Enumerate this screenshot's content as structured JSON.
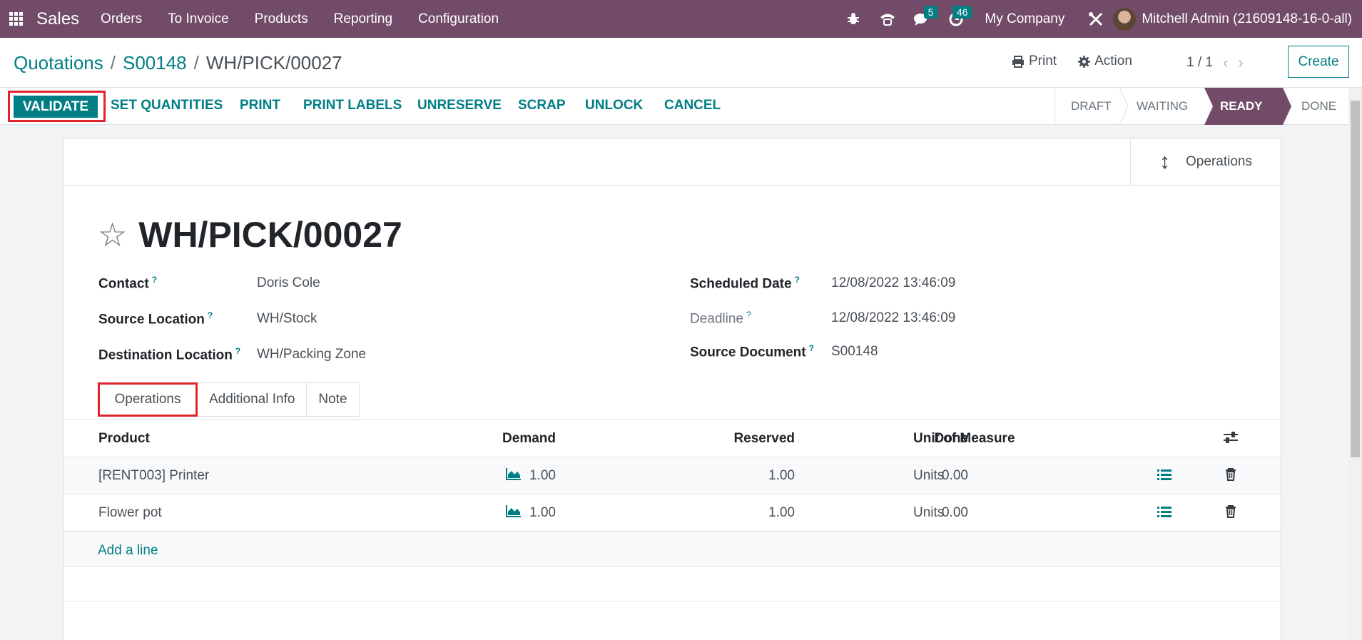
{
  "navbar": {
    "brand": "Sales",
    "menu": [
      "Orders",
      "To Invoice",
      "Products",
      "Reporting",
      "Configuration"
    ],
    "messages_count": "5",
    "activities_count": "46",
    "company": "My Company",
    "user": "Mitchell Admin (21609148-16-0-all)"
  },
  "breadcrumb": {
    "items": [
      "Quotations",
      "S00148"
    ],
    "current": "WH/PICK/00027"
  },
  "control": {
    "print_label": "Print",
    "action_label": "Action",
    "pager": "1 / 1",
    "create_label": "Create"
  },
  "statusbar": {
    "validate_label": "VALIDATE",
    "buttons": [
      "SET QUANTITIES",
      "PRINT",
      "PRINT LABELS",
      "UNRESERVE",
      "SCRAP",
      "UNLOCK",
      "CANCEL"
    ],
    "stages": [
      "DRAFT",
      "WAITING",
      "READY",
      "DONE"
    ],
    "active_stage": "READY"
  },
  "sheet": {
    "smart_button": "Operations",
    "title": "WH/PICK/00027",
    "fields_left": [
      {
        "label": "Contact",
        "value": "Doris Cole"
      },
      {
        "label": "Source Location",
        "value": "WH/Stock"
      },
      {
        "label": "Destination Location",
        "value": "WH/Packing Zone"
      }
    ],
    "fields_right": [
      {
        "label": "Scheduled Date",
        "value": "12/08/2022 13:46:09"
      },
      {
        "label": "Deadline",
        "value": "12/08/2022 13:46:09"
      },
      {
        "label": "Source Document",
        "value": "S00148"
      }
    ],
    "tabs": [
      "Operations",
      "Additional Info",
      "Note"
    ],
    "active_tab": "Operations"
  },
  "table": {
    "headers": [
      "Product",
      "Demand",
      "Reserved",
      "Done",
      "Unit of Measure"
    ],
    "rows": [
      {
        "product": "[RENT003] Printer",
        "demand": "1.00",
        "reserved": "1.00",
        "done": "0.00",
        "uom": "Units"
      },
      {
        "product": "Flower pot",
        "demand": "1.00",
        "reserved": "1.00",
        "done": "0.00",
        "uom": "Units"
      }
    ],
    "add_line_label": "Add a line"
  },
  "colors": {
    "brand": "#714b67",
    "accent": "#017e84",
    "highlight": "#e0242b"
  }
}
